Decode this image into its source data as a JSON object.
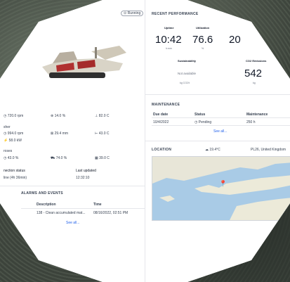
{
  "status_badge": "Running",
  "machine": {
    "stats_row1": [
      "720.0 rpm",
      "14.0 %",
      "82.0 C"
    ],
    "stats_row2_label": "sher",
    "stats_row2": [
      "994.0 rpm",
      "29.4 mm",
      "43.0 C"
    ],
    "stats_row2_extra": "58.0 kW",
    "stats_row3_label": "roses",
    "stats_row3": [
      "43.0 %",
      "74.0 %",
      "39.0 C"
    ],
    "connection_label": "nection status",
    "connection_value": "line (4h 36min)",
    "last_updated_label": "Last updated",
    "last_updated_value": "12:32:10"
  },
  "alarms": {
    "title": "ALARMS AND EVENTS",
    "col_description": "Description",
    "col_time": "Time",
    "rows": [
      {
        "description": "138 - Clean accumulated mat...",
        "time": "08/16/2022, 02:51 PM"
      }
    ],
    "see_all": "See all..."
  },
  "performance": {
    "title": "RECENT PERFORMANCE",
    "uptime_label": "Uptime",
    "uptime_value": "10:42",
    "uptime_unit": "h:mm",
    "utilization_label": "Utilization",
    "utilization_value": "76.6",
    "utilization_unit": "%",
    "third_value": "20",
    "sustainability_label": "Sustainability",
    "sustainability_value": "Not available",
    "sustainability_unit": "kg CO2/t",
    "co2_label": "CO2 Emissions",
    "co2_value": "542",
    "co2_unit": "kg"
  },
  "maintenance": {
    "title": "MAINTENANCE",
    "col_due": "Due date",
    "col_status": "Status",
    "col_maint": "Maintenance",
    "rows": [
      {
        "due": "10/4/2022",
        "status": "Pending",
        "maint": "250 h"
      }
    ],
    "see_all": "See all..."
  },
  "location": {
    "title": "LOCATION",
    "temp": "19.4°C",
    "place": "PL26, United Kingdom"
  },
  "colors": {
    "accent": "#2563eb",
    "panel": "#ffffff",
    "border": "#e5e7eb"
  }
}
